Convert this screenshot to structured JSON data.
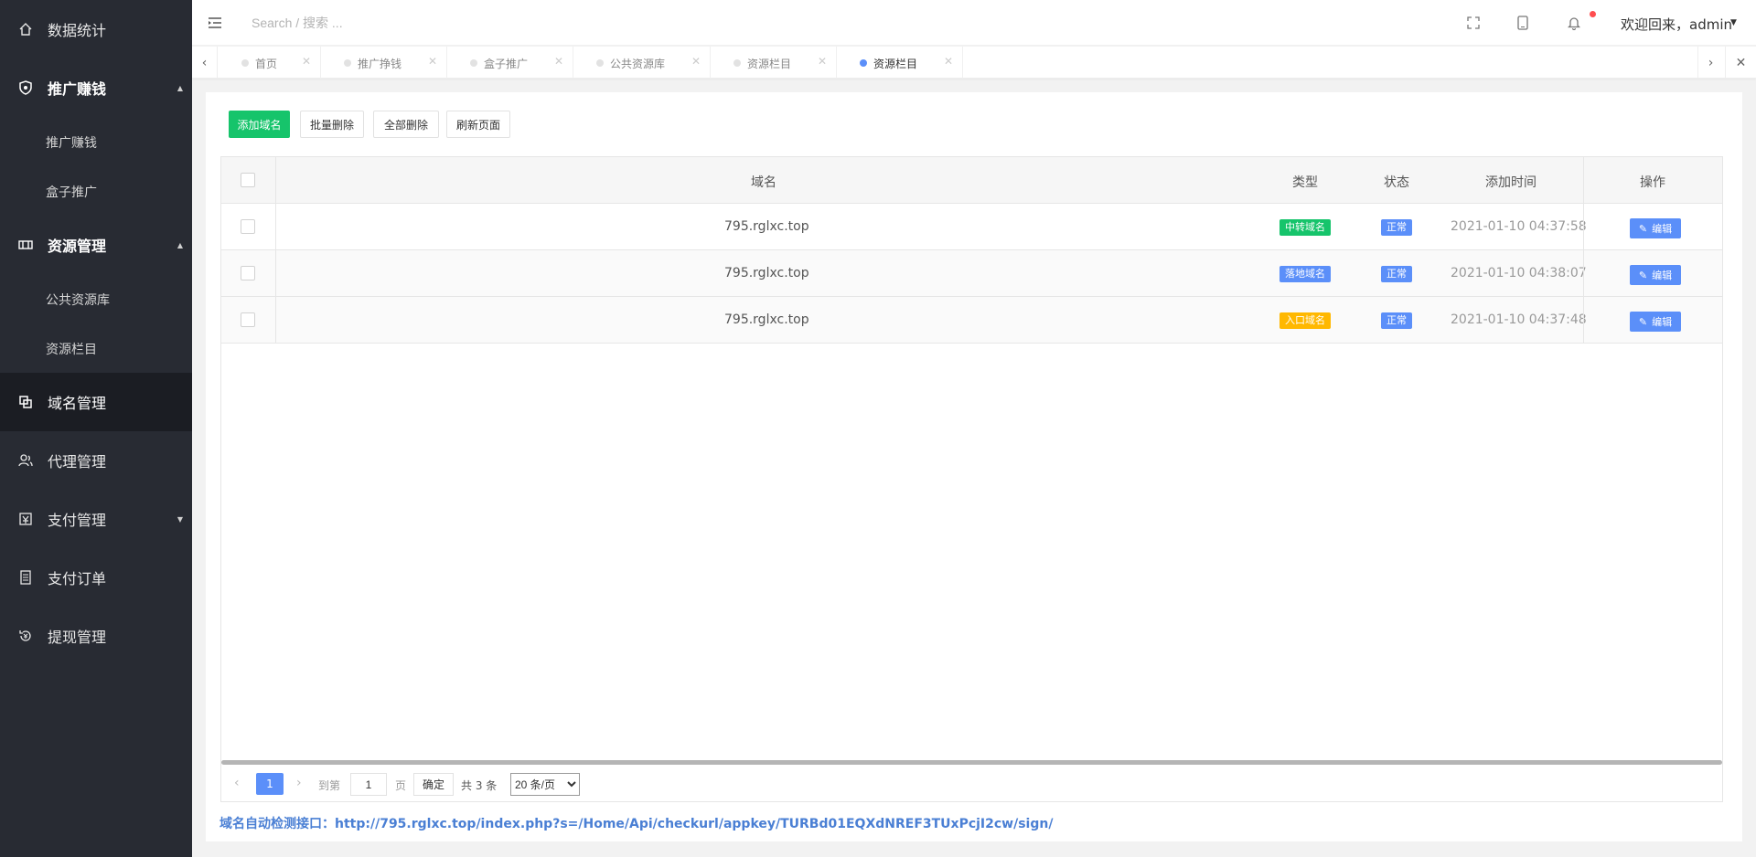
{
  "sidebar": {
    "items": [
      {
        "label": "数据统计",
        "icon": "home-icon"
      },
      {
        "label": "推广赚钱",
        "icon": "shield-icon"
      },
      {
        "label": "推广赚钱",
        "icon": ""
      },
      {
        "label": "盒子推广",
        "icon": ""
      },
      {
        "label": "资源管理",
        "icon": "resource-icon"
      },
      {
        "label": "公共资源库",
        "icon": ""
      },
      {
        "label": "资源栏目",
        "icon": ""
      },
      {
        "label": "域名管理",
        "icon": "copy-icon"
      },
      {
        "label": "代理管理",
        "icon": "users-icon"
      },
      {
        "label": "支付管理",
        "icon": "wallet-icon"
      },
      {
        "label": "支付订单",
        "icon": "receipt-icon"
      },
      {
        "label": "提现管理",
        "icon": "withdraw-icon"
      }
    ]
  },
  "header": {
    "search_placeholder": "Search / 搜索 ...",
    "welcome": "欢迎回来，admin"
  },
  "tabs": [
    {
      "label": "首页",
      "active": false
    },
    {
      "label": "推广挣钱",
      "active": false
    },
    {
      "label": "盒子推广",
      "active": false
    },
    {
      "label": "公共资源库",
      "active": false
    },
    {
      "label": "资源栏目",
      "active": false
    },
    {
      "label": "资源栏目",
      "active": true
    }
  ],
  "toolbar": {
    "add": "添加域名",
    "batch_delete": "批量删除",
    "delete_all": "全部删除",
    "refresh": "刷新页面"
  },
  "table": {
    "headers": {
      "domain": "域名",
      "type": "类型",
      "status": "状态",
      "time": "添加时间",
      "action": "操作"
    },
    "rows": [
      {
        "domain": "795.rglxc.top",
        "type": "中转域名",
        "type_color": "#16c46b",
        "status": "正常",
        "time": "2021-01-10 04:37:58",
        "action": "编辑"
      },
      {
        "domain": "795.rglxc.top",
        "type": "落地域名",
        "type_color": "#5b8ff9",
        "status": "正常",
        "time": "2021-01-10 04:38:07",
        "action": "编辑"
      },
      {
        "domain": "795.rglxc.top",
        "type": "入口域名",
        "type_color": "#ffb800",
        "status": "正常",
        "time": "2021-01-10 04:37:48",
        "action": "编辑"
      }
    ]
  },
  "pager": {
    "current": "1",
    "goto_label": "到第",
    "page_value": "1",
    "page_unit": "页",
    "confirm": "确定",
    "total": "共 3 条",
    "page_size": "20 条/页"
  },
  "footer": {
    "link": "域名自动检测接口：http://795.rglxc.top/index.php?s=/Home/Api/checkurl/appkey/TURBd01EQXdNREF3TUxPcjI2cw/sign/"
  },
  "colors": {
    "sidebar_bg": "#282b33",
    "primary": "#16c46b",
    "accent": "#5b8ff9",
    "warning": "#ffb800"
  }
}
